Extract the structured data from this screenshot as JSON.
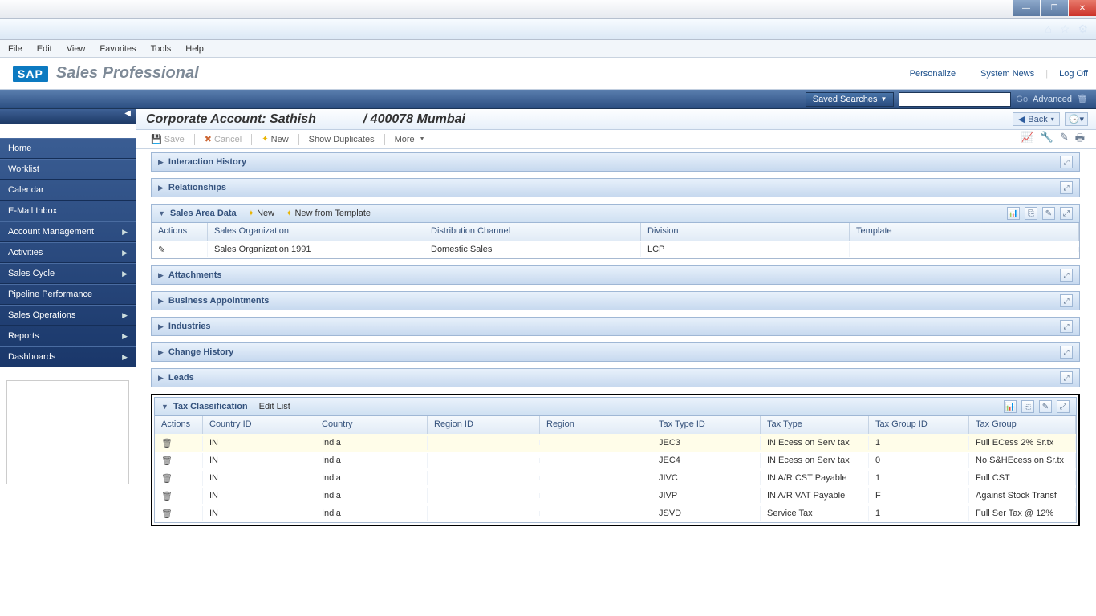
{
  "window": {
    "min": "—",
    "max": "❐",
    "close": "✕"
  },
  "menu": {
    "file": "File",
    "edit": "Edit",
    "view": "View",
    "favorites": "Favorites",
    "tools": "Tools",
    "help": "Help"
  },
  "header": {
    "logo": "SAP",
    "product": "Sales Professional",
    "links": {
      "personalize": "Personalize",
      "system_news": "System News",
      "log_off": "Log Off"
    }
  },
  "search": {
    "saved": "Saved Searches",
    "go": "Go",
    "advanced": "Advanced"
  },
  "sidebar": {
    "items": [
      {
        "label": "Home",
        "arrow": false
      },
      {
        "label": "Worklist",
        "arrow": false
      },
      {
        "label": "Calendar",
        "arrow": false
      },
      {
        "label": "E-Mail Inbox",
        "arrow": false
      },
      {
        "label": "Account Management",
        "arrow": true
      },
      {
        "label": "Activities",
        "arrow": true
      },
      {
        "label": "Sales Cycle",
        "arrow": true
      },
      {
        "label": "Pipeline Performance",
        "arrow": false
      },
      {
        "label": "Sales Operations",
        "arrow": true
      },
      {
        "label": "Reports",
        "arrow": true
      },
      {
        "label": "Dashboards",
        "arrow": true
      }
    ]
  },
  "page": {
    "title_prefix": "Corporate Account: Sathish",
    "title_suffix": "/ 400078 Mumbai",
    "back": "Back"
  },
  "toolbar": {
    "save": "Save",
    "cancel": "Cancel",
    "new": "New",
    "show_duplicates": "Show Duplicates",
    "more": "More"
  },
  "panels": {
    "interaction_history": "Interaction History",
    "relationships": "Relationships",
    "sales_area_data": {
      "title": "Sales Area Data",
      "new": "New",
      "new_from_template": "New from Template",
      "cols": {
        "actions": "Actions",
        "org": "Sales Organization",
        "dist": "Distribution Channel",
        "div": "Division",
        "tpl": "Template"
      },
      "rows": [
        {
          "org": "Sales Organization 1991",
          "dist": "Domestic Sales",
          "div": "LCP",
          "tpl": ""
        }
      ]
    },
    "attachments": "Attachments",
    "business_appointments": "Business Appointments",
    "industries": "Industries",
    "change_history": "Change History",
    "leads": "Leads",
    "tax_classification": {
      "title": "Tax Classification",
      "edit_list": "Edit List",
      "cols": {
        "actions": "Actions",
        "country_id": "Country ID",
        "country": "Country",
        "region_id": "Region ID",
        "region": "Region",
        "tax_type_id": "Tax Type ID",
        "tax_type": "Tax Type",
        "tax_group_id": "Tax Group ID",
        "tax_group": "Tax Group"
      },
      "rows": [
        {
          "country_id": "IN",
          "country": "India",
          "region_id": "",
          "region": "",
          "tax_type_id": "JEC3",
          "tax_type": "IN Ecess on Serv tax",
          "tax_group_id": "1",
          "tax_group": "Full ECess 2% Sr.tx"
        },
        {
          "country_id": "IN",
          "country": "India",
          "region_id": "",
          "region": "",
          "tax_type_id": "JEC4",
          "tax_type": "IN Ecess on Serv tax",
          "tax_group_id": "0",
          "tax_group": "No S&HEcess on Sr.tx"
        },
        {
          "country_id": "IN",
          "country": "India",
          "region_id": "",
          "region": "",
          "tax_type_id": "JIVC",
          "tax_type": "IN A/R CST Payable",
          "tax_group_id": "1",
          "tax_group": "Full CST"
        },
        {
          "country_id": "IN",
          "country": "India",
          "region_id": "",
          "region": "",
          "tax_type_id": "JIVP",
          "tax_type": "IN A/R VAT Payable",
          "tax_group_id": "F",
          "tax_group": "Against Stock Transf"
        },
        {
          "country_id": "IN",
          "country": "India",
          "region_id": "",
          "region": "",
          "tax_type_id": "JSVD",
          "tax_type": "Service Tax",
          "tax_group_id": "1",
          "tax_group": "Full Ser Tax @ 12%"
        }
      ]
    }
  }
}
